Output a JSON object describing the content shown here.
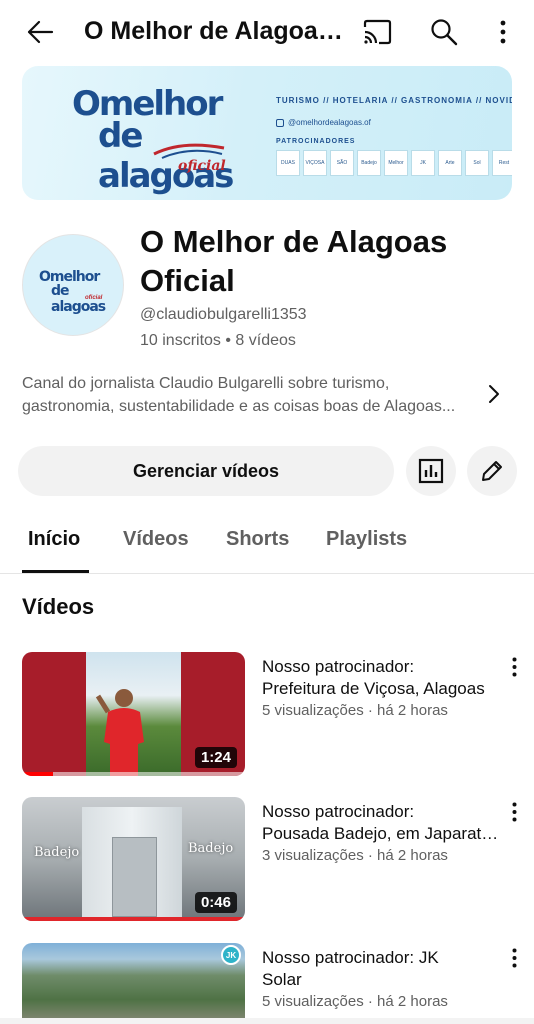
{
  "appbar": {
    "title": "O Melhor de Alagoas Oficial"
  },
  "banner": {
    "logo_line1": "Omelhor",
    "logo_line2": "de alagoas",
    "logo_line3": "oficial",
    "tagline": "TURISMO // HOTELARIA // GASTRONOMIA // NOVIDADES",
    "instagram": "@omelhordealagoas.of",
    "sponsors_label": "PATROCINADORES",
    "sponsors": [
      "DUAS",
      "VIÇOSA",
      "SÃO",
      "Badejo",
      "Melhor",
      "JK",
      "Arte",
      "Sol",
      "Rest"
    ]
  },
  "channel": {
    "name": "O Melhor de Alagoas Oficial",
    "handle": "@claudiobulgarelli1353",
    "stats": "10 inscritos • 8 vídeos",
    "description_line1": "Canal do jornalista Claudio Bulgarelli sobre turismo,",
    "description_line2": "gastronomia, sustentabilidade e as coisas boas de Alagoas..."
  },
  "actions": {
    "manage_label": "Gerenciar vídeos"
  },
  "tabs": [
    {
      "label": "Início",
      "active": true
    },
    {
      "label": "Vídeos",
      "active": false
    },
    {
      "label": "Shorts",
      "active": false
    },
    {
      "label": "Playlists",
      "active": false
    }
  ],
  "videos_section": {
    "title": "Vídeos",
    "items": [
      {
        "title_line1": "Nosso patrocinador:",
        "title_line2": "Prefeitura de Viçosa, Alagoas",
        "meta": "5 visualizações · há 2 horas",
        "duration": "1:24",
        "progress": 0.14
      },
      {
        "title_line1": "Nosso patrocinador:",
        "title_line2": "Pousada Badejo, em Japaratinga",
        "meta": "3 visualizações · há 2 horas",
        "duration": "0:46",
        "progress": 0.0,
        "thumb_label": "Badejo"
      },
      {
        "title_line1": "Nosso patrocinador: JK",
        "title_line2": "Solar",
        "meta": "5 visualizações · há 2 horas",
        "thumb_badge": "JK"
      }
    ]
  },
  "colors": {
    "brand_blue": "#1d4f8f",
    "brand_red": "#c0272d",
    "progress_red": "#ff0000"
  }
}
